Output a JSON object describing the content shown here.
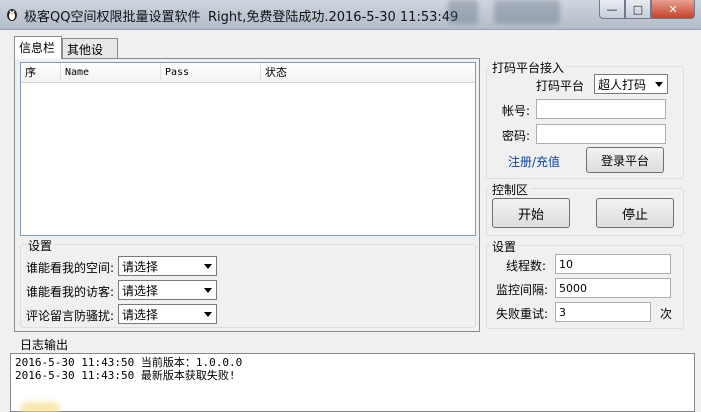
{
  "window": {
    "title": "极客QQ空间权限批量设置软件",
    "status": "Right,免费登陆成功.2016-5-30 11:53:49",
    "controls": {
      "minimize": "—",
      "maximize": "□",
      "close": "✕"
    }
  },
  "tabs": [
    {
      "label": "信息栏"
    },
    {
      "label": "其他设置"
    }
  ],
  "list": {
    "columns": [
      "序",
      "Name",
      "Pass",
      "状态"
    ]
  },
  "captcha": {
    "group_title": "打码平台接入",
    "platform_label": "打码平台",
    "platform_value": "超人打码",
    "account_label": "帐号:",
    "account_value": "",
    "password_label": "密码:",
    "password_value": "",
    "register_link": "注册/充值",
    "login_button": "登录平台"
  },
  "control": {
    "group_title": "控制区",
    "start_button": "开始",
    "stop_button": "停止"
  },
  "privacy": {
    "group_title": "设置",
    "rows": [
      {
        "label": "谁能看我的空间:",
        "value": "请选择"
      },
      {
        "label": "谁能看我的访客:",
        "value": "请选择"
      },
      {
        "label": "评论留言防骚扰:",
        "value": "请选择"
      }
    ]
  },
  "settings": {
    "group_title": "设置",
    "threads_label": "线程数:",
    "threads_value": "10",
    "interval_label": "监控间隔:",
    "interval_value": "5000",
    "retry_label": "失败重试:",
    "retry_value": "3",
    "retry_unit": "次"
  },
  "log": {
    "title": "日志输出",
    "lines": [
      "2016-5-30 11:43:50 当前版本：1.0.0.0",
      "2016-5-30 11:43:50 最新版本获取失败!"
    ]
  }
}
